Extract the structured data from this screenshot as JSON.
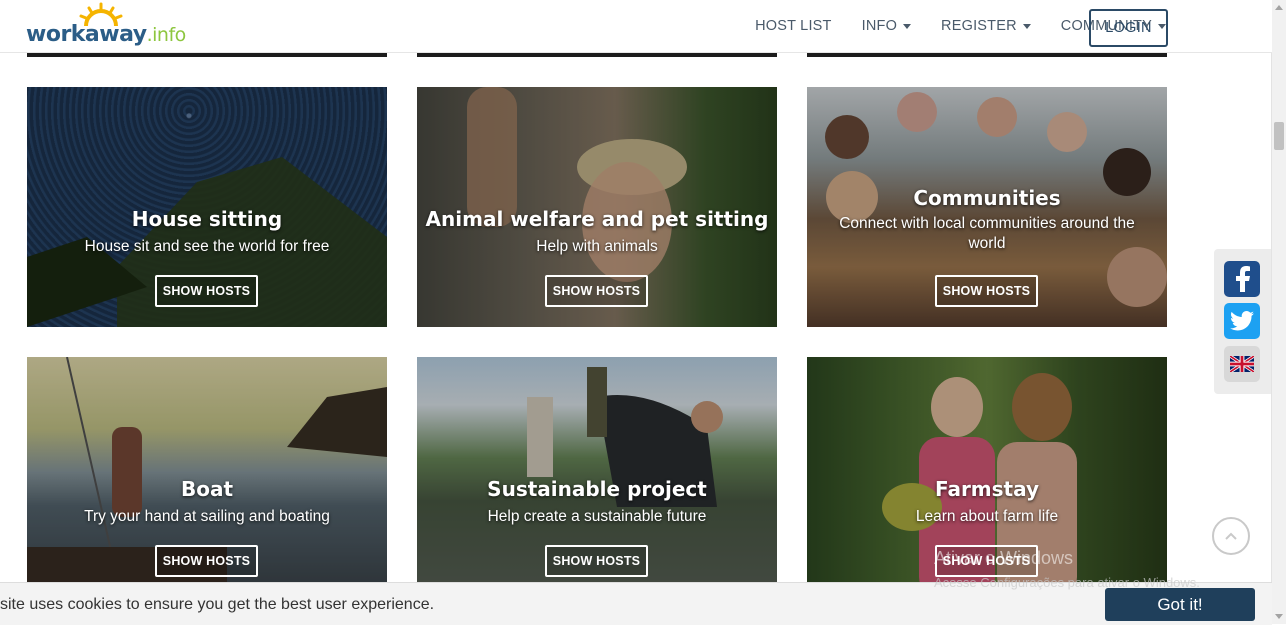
{
  "brand": {
    "name": "workaway",
    "tld": ".info"
  },
  "nav": {
    "host_list": "HOST LIST",
    "info": "INFO",
    "register": "REGISTER",
    "community": "COMMUNITY",
    "login": "LOGIN"
  },
  "cards": [
    {
      "title": "House sitting",
      "subtitle": "House sit and see the world for free",
      "button": "SHOW HOSTS"
    },
    {
      "title": "Animal welfare and pet sitting",
      "subtitle": "Help with animals",
      "button": "SHOW HOSTS"
    },
    {
      "title": "Communities",
      "subtitle": "Connect with local communities around the world",
      "button": "SHOW HOSTS"
    },
    {
      "title": "Boat",
      "subtitle": "Try your hand at sailing and boating",
      "button": "SHOW HOSTS"
    },
    {
      "title": "Sustainable project",
      "subtitle": "Help create a sustainable future",
      "button": "SHOW HOSTS"
    },
    {
      "title": "Farmstay",
      "subtitle": "Learn about farm life",
      "button": "SHOW HOSTS"
    }
  ],
  "social": [
    "facebook-icon",
    "twitter-icon",
    "uk-flag-icon"
  ],
  "cookie": {
    "text": "site uses cookies to ensure you get the best user experience.",
    "button": "Got it!"
  },
  "watermark": {
    "line1": "Ativar o Windows",
    "line2": "Acesse Configurações para ativar o Windows."
  },
  "colors": {
    "brand_blue": "#2b5d87",
    "brand_green": "#8dc63f",
    "accent_dark": "#1f3f5b"
  }
}
